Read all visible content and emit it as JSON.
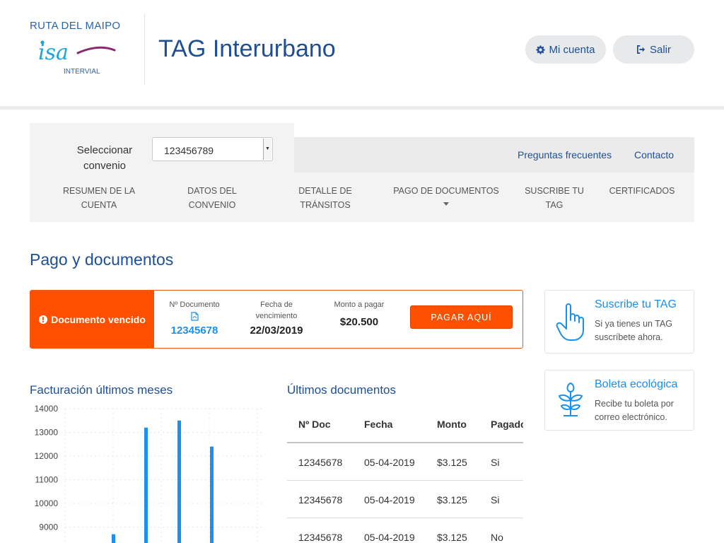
{
  "logo": {
    "top_text": "RUTA DEL MAIPO",
    "mark_text": "isa",
    "sub_text": "INTERVIAL"
  },
  "header": {
    "title": "TAG Interurbano",
    "account_label": "Mi cuenta",
    "exit_label": "Salir"
  },
  "selector": {
    "label": "Seleccionar convenio",
    "value": "123456789"
  },
  "top_links": {
    "faq": "Preguntas frecuentes",
    "contact": "Contacto"
  },
  "nav": {
    "items": [
      {
        "line1": "RESUMEN DE LA",
        "line2": "CUENTA"
      },
      {
        "line1": "DATOS DEL",
        "line2": "CONVENIO"
      },
      {
        "line1": "DETALLE DE",
        "line2": "TRÁNSITOS"
      },
      {
        "line1": "PAGO DE DOCUMENTOS",
        "line2": ""
      },
      {
        "line1": "SUSCRIBE TU",
        "line2": "TAG"
      },
      {
        "line1": "CERTIFICADOS",
        "line2": ""
      }
    ]
  },
  "page": {
    "title": "Pago y documentos"
  },
  "alert": {
    "status": "Documento vencido",
    "doc_label": "Nº Documento",
    "doc_number": "12345678",
    "due_label": "Fecha de vencimiento",
    "due_date": "22/03/2019",
    "amount_label": "Monto a pagar",
    "amount": "$20.500",
    "pay_button": "PAGAR AQUÍ"
  },
  "cards": [
    {
      "title": "Suscribe tu TAG",
      "description": "Si ya tienes un TAG suscríbete ahora.",
      "icon": "hand-pointer-icon"
    },
    {
      "title": "Boleta ecológica",
      "description": "Recibe tu boleta por correo electrónico.",
      "icon": "plant-icon"
    }
  ],
  "billing": {
    "title": "Facturación últimos meses"
  },
  "chart_data": {
    "type": "bar",
    "title": "Facturación últimos meses",
    "xlabel": "",
    "ylabel": "",
    "ylim": [
      8600,
      14000
    ],
    "yticks": [
      14000,
      13000,
      12000,
      11000,
      10000,
      9000
    ],
    "grid": true,
    "legend": "none",
    "bar_color": "#1a91f0",
    "series": [
      {
        "values": [
          8700,
          13200,
          13500,
          12400
        ]
      }
    ]
  },
  "documents": {
    "title": "Últimos documentos",
    "columns": [
      "Nº Doc",
      "Fecha",
      "Monto",
      "Pagado"
    ],
    "rows": [
      [
        "12345678",
        "05-04-2019",
        "$3.125",
        "Si"
      ],
      [
        "12345678",
        "05-04-2019",
        "$3.125",
        "Si"
      ],
      [
        "12345678",
        "05-04-2019",
        "$3.125",
        "No"
      ]
    ]
  },
  "colors": {
    "brand_blue": "#1e4f94",
    "accent_orange": "#fe5000",
    "link_blue": "#1a91ee"
  }
}
